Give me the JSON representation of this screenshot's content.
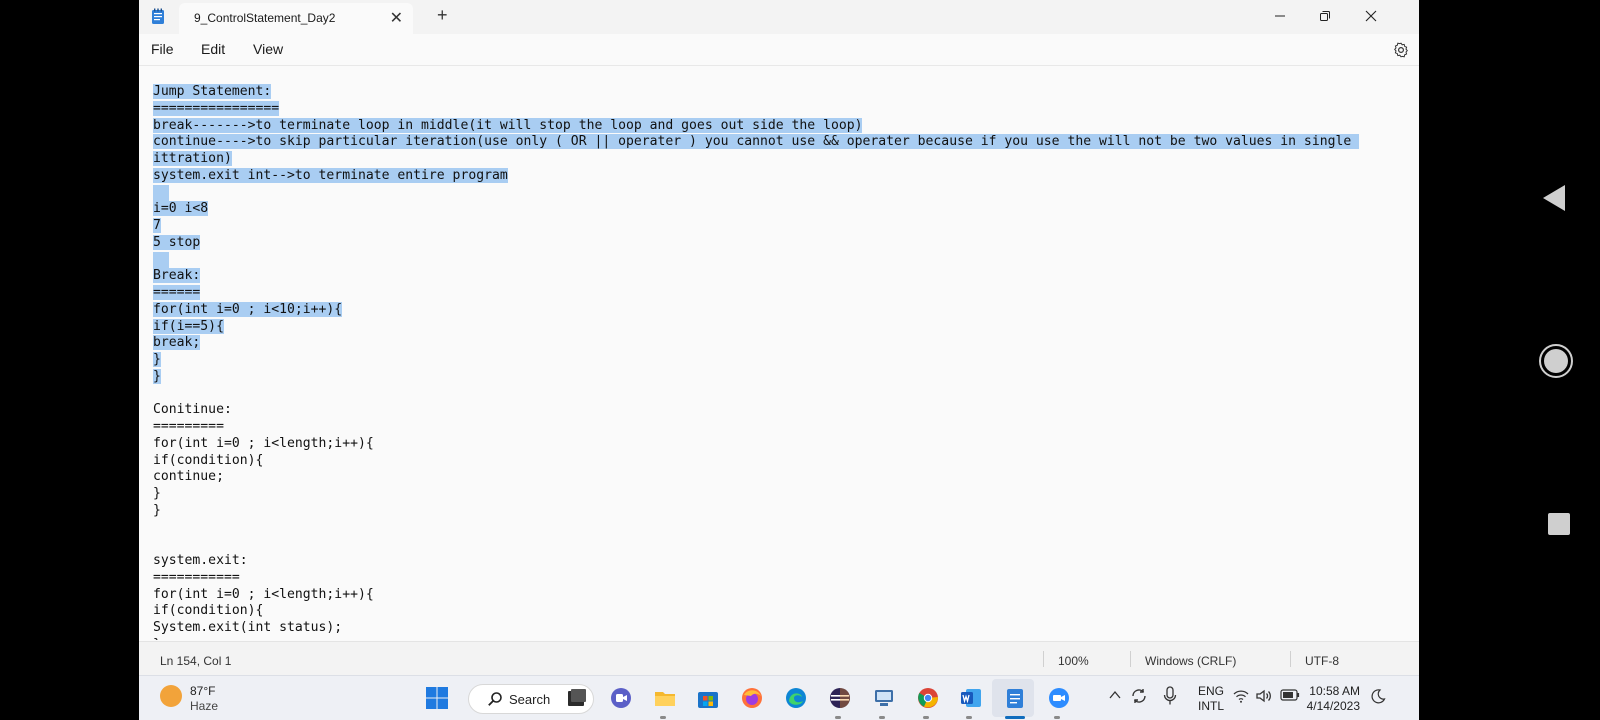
{
  "window": {
    "tab_title": "9_ControlStatement_Day2",
    "tab_close": "✕",
    "new_tab": "+"
  },
  "menu": {
    "file": "File",
    "edit": "Edit",
    "view": "View"
  },
  "editor": {
    "lines": [
      "Jump Statement:",
      "================",
      "break------->to terminate loop in middle(it will stop the loop and goes out side the loop)",
      "continue---->to skip particular iteration(use only ( OR || operater ) you cannot use && operater because if you use the will not be two values in single ",
      "ittration)",
      "system.exit int-->to terminate entire program",
      "",
      "i=0 i<8",
      "7",
      "5 stop",
      "",
      "Break:",
      "======",
      "for(int i=0 ; i<10;i++){",
      "if(i==5){",
      "break;",
      "}",
      "}",
      "",
      "Conitinue:",
      "=========",
      "for(int i=0 ; i<length;i++){",
      "if(condition){",
      "continue;",
      "}",
      "}",
      "",
      "",
      "system.exit:",
      "===========",
      "for(int i=0 ; i<length;i++){",
      "if(condition){",
      "System.exit(int status);",
      "}"
    ],
    "selected_line_count": 18
  },
  "status": {
    "position": "Ln 154, Col 1",
    "zoom": "100%",
    "line_ending": "Windows (CRLF)",
    "encoding": "UTF-8"
  },
  "taskbar": {
    "weather_temp": "87°F",
    "weather_condition": "Haze",
    "search_label": "Search",
    "apps": [
      "task-view",
      "meet",
      "file-explorer",
      "microsoft-store",
      "firefox",
      "edge",
      "eclipse",
      "network-app",
      "chrome",
      "word",
      "notepad",
      "zoom"
    ],
    "language_top": "ENG",
    "language_bottom": "INTL",
    "time": "10:58 AM",
    "date": "4/14/2023"
  },
  "colors": {
    "selection": "#a9cdf2",
    "windows_blue": "#0f6cbd"
  }
}
